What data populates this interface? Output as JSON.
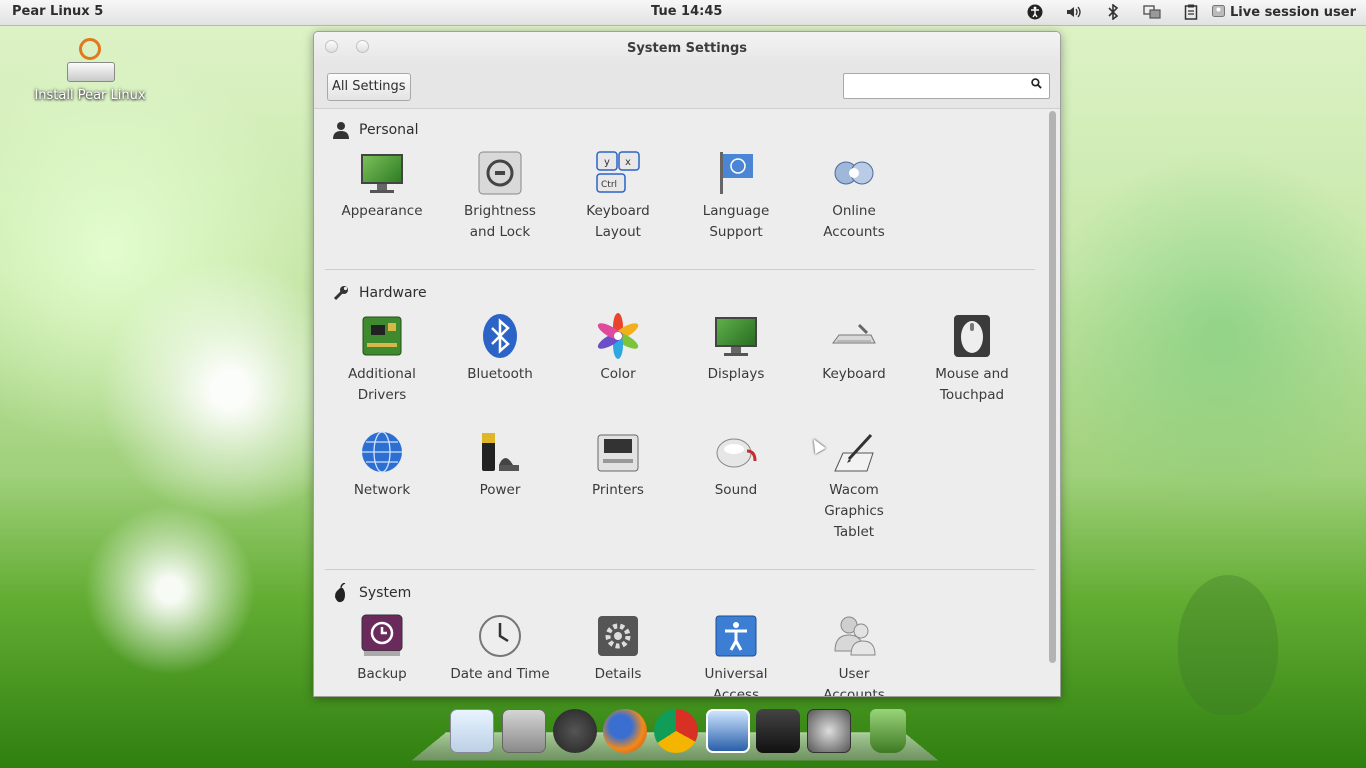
{
  "top_panel": {
    "title": "Pear Linux 5",
    "clock": "Tue 14:45",
    "user": "Live session user",
    "icons": [
      "accessibility-icon",
      "volume-icon",
      "bluetooth-icon",
      "network-icon",
      "clipboard-icon",
      "user-icon"
    ]
  },
  "desktop": {
    "install_label": "Install Pear Linux"
  },
  "window": {
    "title": "System Settings",
    "all_settings_label": "All Settings",
    "search_value": "",
    "sections": [
      {
        "name": "Personal",
        "items": [
          {
            "label": "Appearance",
            "icon": "appearance-icon"
          },
          {
            "label": "Brightness\nand Lock",
            "icon": "brightness-icon"
          },
          {
            "label": "Keyboard\nLayout",
            "icon": "keyboard-layout-icon"
          },
          {
            "label": "Language\nSupport",
            "icon": "language-icon"
          },
          {
            "label": "Online\nAccounts",
            "icon": "online-accounts-icon"
          }
        ]
      },
      {
        "name": "Hardware",
        "items": [
          {
            "label": "Additional\nDrivers",
            "icon": "drivers-icon"
          },
          {
            "label": "Bluetooth",
            "icon": "bluetooth-icon"
          },
          {
            "label": "Color",
            "icon": "color-icon"
          },
          {
            "label": "Displays",
            "icon": "displays-icon"
          },
          {
            "label": "Keyboard",
            "icon": "keyboard-icon"
          },
          {
            "label": "Mouse and\nTouchpad",
            "icon": "mouse-icon"
          },
          {
            "label": "Network",
            "icon": "network-icon"
          },
          {
            "label": "Power",
            "icon": "power-icon"
          },
          {
            "label": "Printers",
            "icon": "printer-icon"
          },
          {
            "label": "Sound",
            "icon": "sound-icon"
          },
          {
            "label": "Wacom\nGraphics\nTablet",
            "icon": "wacom-icon"
          }
        ]
      },
      {
        "name": "System",
        "items": [
          {
            "label": "Backup",
            "icon": "backup-icon"
          },
          {
            "label": "Date and Time",
            "icon": "clock-icon"
          },
          {
            "label": "Details",
            "icon": "details-icon"
          },
          {
            "label": "Universal\nAccess",
            "icon": "universal-access-icon"
          },
          {
            "label": "User\nAccounts",
            "icon": "user-accounts-icon"
          }
        ]
      }
    ]
  },
  "dock": {
    "items": [
      "monitor-icon",
      "rocket-icon",
      "app-store-icon",
      "firefox-icon",
      "chrome-icon",
      "photos-icon",
      "video-icon",
      "settings-icon",
      "trash-icon"
    ]
  },
  "colors": {
    "panel_bg": "#e8e8e8",
    "window_bg": "#ededed",
    "accent_blue": "#2b63c6",
    "grass_green": "#5fa832"
  }
}
